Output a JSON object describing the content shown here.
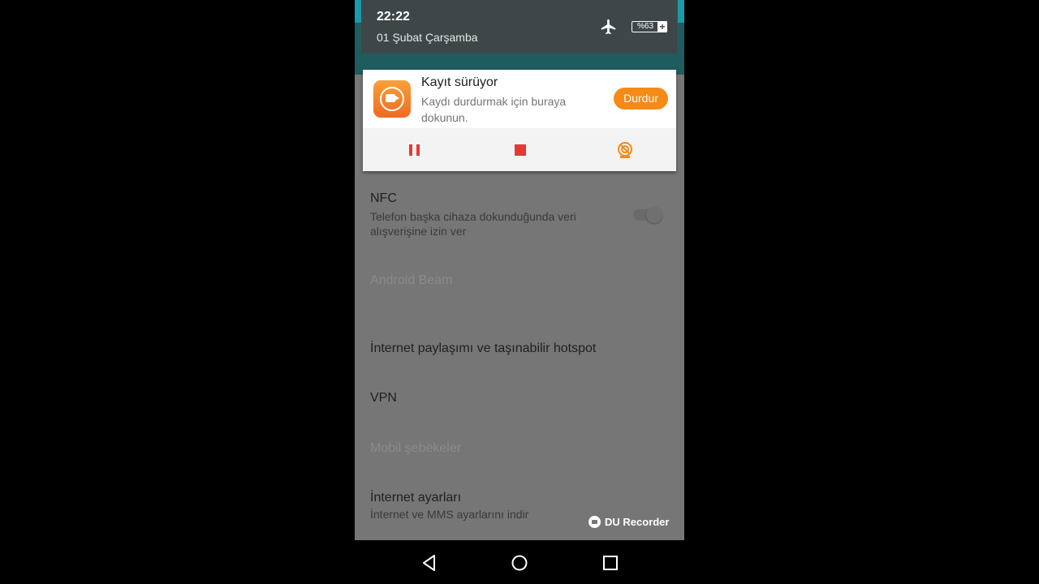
{
  "status_bar": {
    "time": "22:22",
    "date": "01 Şubat Çarşamba",
    "battery": "%63",
    "icons": [
      "airplane-mode-icon",
      "battery-icon"
    ]
  },
  "notification": {
    "app_icon": "du-recorder-icon",
    "title": "Kayıt sürüyor",
    "text": "Kaydı durdurmak için buraya dokunun.",
    "stop_label": "Durdur",
    "actions": [
      "pause-icon",
      "stop-icon",
      "camera-icon"
    ],
    "accent": "#f58a16",
    "action_color": "#e53935"
  },
  "settings": [
    {
      "title": "NFC",
      "subtitle": "Telefon başka cihaza dokunduğunda veri alışverişine izin ver",
      "toggle": "off"
    },
    {
      "title": "Android Beam",
      "subtitle": "",
      "disabled": true
    },
    {
      "title": "İnternet paylaşımı ve taşınabilir hotspot"
    },
    {
      "title": "VPN"
    },
    {
      "title": "Mobil şebekeler",
      "disabled": true
    },
    {
      "title": "İnternet ayarları",
      "subtitle": "İnternet ve MMS ayarlarını indir"
    }
  ],
  "watermark": "DU Recorder",
  "navigation": [
    "back-icon",
    "home-icon",
    "recents-icon"
  ]
}
